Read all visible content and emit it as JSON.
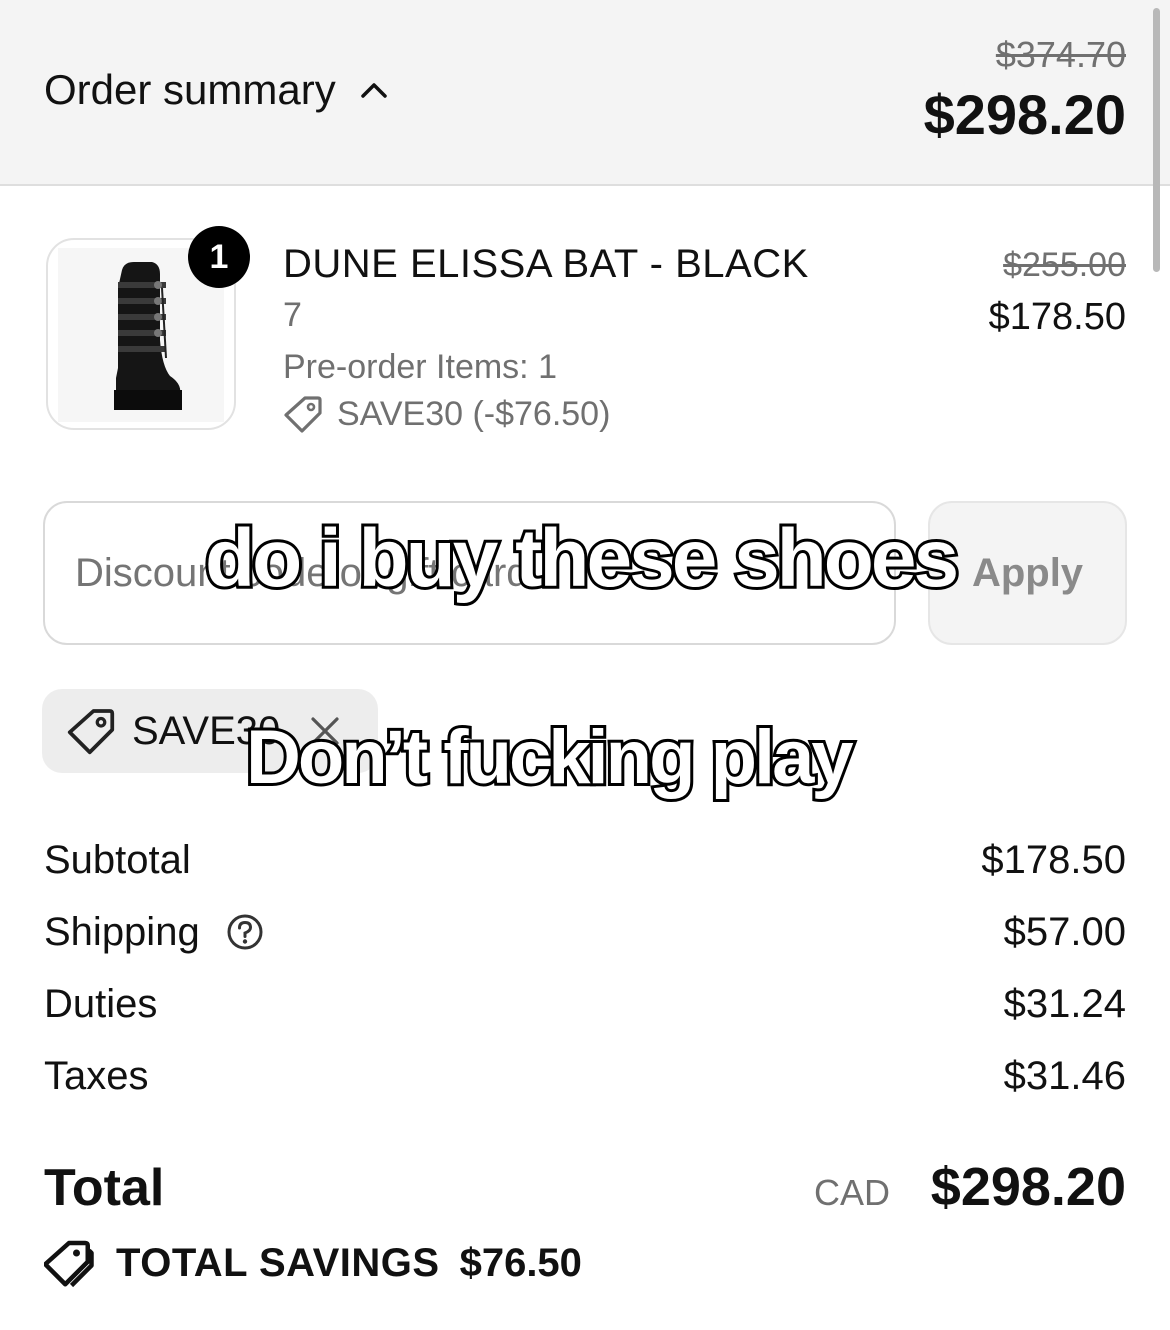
{
  "header": {
    "title": "Order summary",
    "original_total": "$374.70",
    "total": "$298.20",
    "toggle_icon": "chevron-up-icon"
  },
  "line_item": {
    "quantity": "1",
    "name": "DUNE ELISSA BAT - BLACK",
    "variant": "7",
    "preorder": "Pre-order Items: 1",
    "discount": "SAVE30 (-$76.50)",
    "original_price": "$255.00",
    "price": "$178.50",
    "image_icon": "boot-product-image"
  },
  "discount_form": {
    "placeholder": "Discount code or gift card",
    "apply_label": "Apply"
  },
  "applied_code": {
    "label": "SAVE30",
    "remove_icon": "close-icon"
  },
  "costs": {
    "subtotal_label": "Subtotal",
    "subtotal": "$178.50",
    "shipping_label": "Shipping",
    "shipping": "$57.00",
    "duties_label": "Duties",
    "duties": "$31.24",
    "taxes_label": "Taxes",
    "taxes": "$31.46"
  },
  "total": {
    "label": "Total",
    "currency": "CAD",
    "value": "$298.20"
  },
  "savings": {
    "label": "TOTAL SAVINGS",
    "value": "$76.50"
  },
  "captions": {
    "top": "do i buy these shoes",
    "bottom": "Don’t fucking play"
  },
  "colors": {
    "header_bg": "#f4f4f4",
    "text": "#111111",
    "muted": "#707070"
  }
}
